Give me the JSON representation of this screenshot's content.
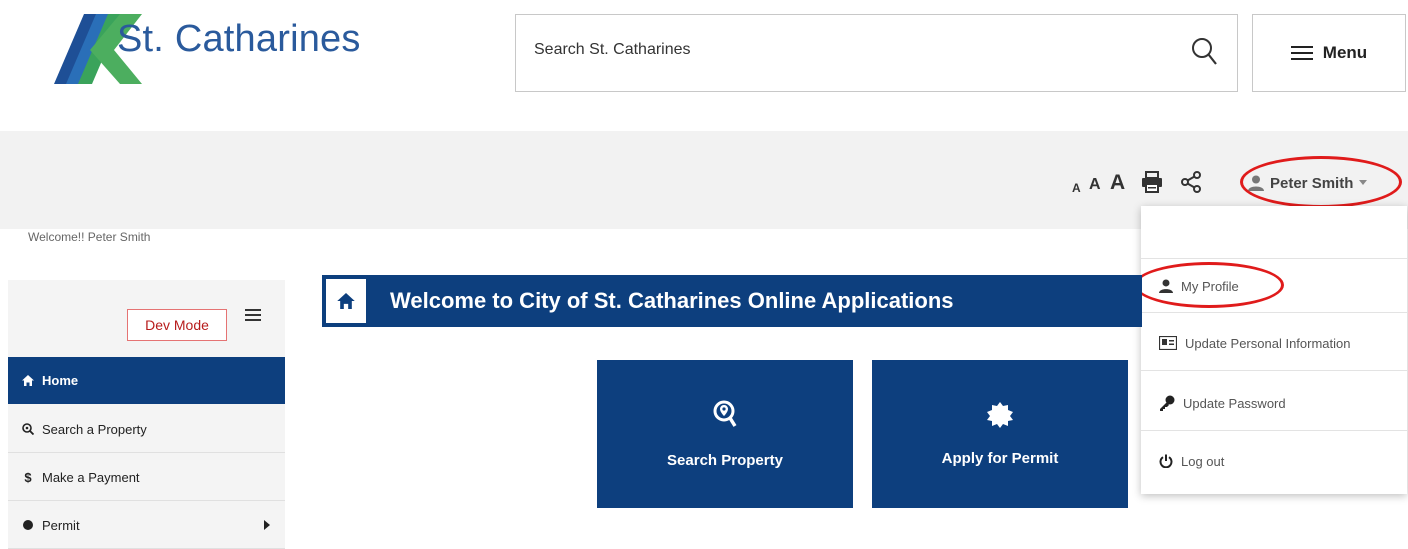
{
  "header": {
    "logo_text": "St. Catharines",
    "search": {
      "placeholder": "Search St. Catharines"
    },
    "menu_label": "Menu"
  },
  "toolbar": {
    "font_sizes": [
      "A",
      "A",
      "A"
    ],
    "user_name": "Peter Smith"
  },
  "user_dropdown": {
    "welcome": "Welcome!! Peter Smith",
    "items": [
      {
        "label": "My Profile",
        "icon": "user-icon"
      },
      {
        "label": "Update Personal Information",
        "icon": "id-card-icon"
      },
      {
        "label": "Update Password",
        "icon": "key-icon"
      },
      {
        "label": "Log out",
        "icon": "power-icon"
      }
    ]
  },
  "sidebar": {
    "dev_mode_label": "Dev Mode",
    "items": [
      {
        "label": "Home",
        "icon": "home-icon",
        "active": true
      },
      {
        "label": "Search a Property",
        "icon": "search-icon"
      },
      {
        "label": "Make a Payment",
        "icon": "dollar-icon",
        "glyph": "$"
      },
      {
        "label": "Permit",
        "icon": "circle-icon"
      }
    ]
  },
  "main": {
    "heading": "Welcome to City of St. Catharines Online Applications",
    "tiles": [
      {
        "label": "Search Property",
        "icon": "search-location-icon"
      },
      {
        "label": "Apply for Permit",
        "icon": "badge-icon"
      }
    ]
  },
  "colors": {
    "brand_blue": "#0d3f7e",
    "logo_blue": "#2a5a9c",
    "logo_green": "#3aa35b",
    "annotation_red": "#e01b1b",
    "toolbar_gray": "#f2f2f2"
  }
}
